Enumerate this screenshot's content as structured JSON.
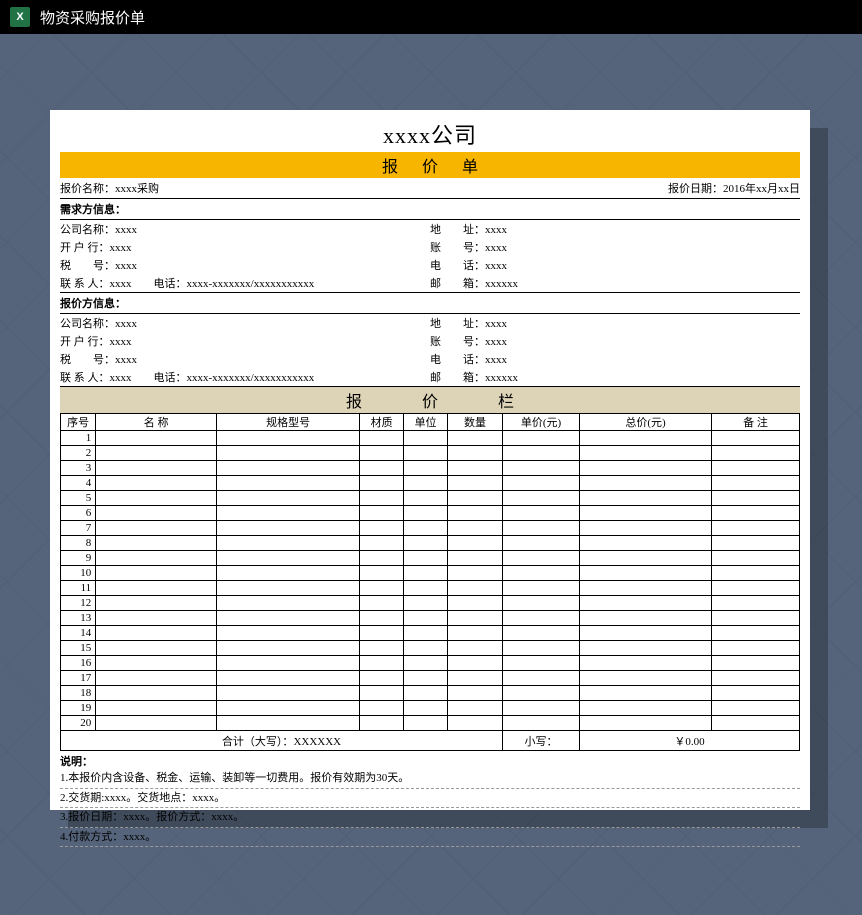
{
  "titlebar": "物资采购报价单",
  "company": "xxxx公司",
  "banner": "报价单",
  "meta": {
    "name_label": "报价名称：",
    "name_value": "xxxx采购",
    "date_label": "报价日期：",
    "date_value": "2016年xx月xx日"
  },
  "demand": {
    "section": "需求方信息：",
    "company_label": "公司名称：",
    "company_value": "xxxx",
    "bank_label": "开 户 行：",
    "bank_value": "xxxx",
    "tax_label": "税　　号：",
    "tax_value": "xxxx",
    "contact_label": "联 系 人：",
    "contact_value": "xxxx",
    "phone_label": "电话：",
    "phone_value": "xxxx-xxxxxxx/xxxxxxxxxxx",
    "addr_label": "地　　址：",
    "addr_value": "xxxx",
    "account_label": "账　　号：",
    "account_value": "xxxx",
    "tel_label": "电　　话：",
    "tel_value": "xxxx",
    "mail_label": "邮　　箱：",
    "mail_value": "xxxxxx"
  },
  "supply": {
    "section": "报价方信息：",
    "company_label": "公司名称：",
    "company_value": "xxxx",
    "bank_label": "开 户 行：",
    "bank_value": "xxxx",
    "tax_label": "税　　号：",
    "tax_value": "xxxx",
    "contact_label": "联 系 人：",
    "contact_value": "xxxx",
    "phone_label": "电话：",
    "phone_value": "xxxx-xxxxxxx/xxxxxxxxxxx",
    "addr_label": "地　　址：",
    "addr_value": "xxxx",
    "account_label": "账　　号：",
    "account_value": "xxxx",
    "tel_label": "电　　话：",
    "tel_value": "xxxx",
    "mail_label": "邮　　箱：",
    "mail_value": "xxxxxx"
  },
  "quote_header": "报价栏",
  "columns": {
    "seq": "序号",
    "name": "名 称",
    "spec": "规格型号",
    "mat": "材质",
    "unit": "单位",
    "qty": "数量",
    "price": "单价(元)",
    "total": "总价(元)",
    "note": "备 注"
  },
  "rows": [
    "1",
    "2",
    "3",
    "4",
    "5",
    "6",
    "7",
    "8",
    "9",
    "10",
    "11",
    "12",
    "13",
    "14",
    "15",
    "16",
    "17",
    "18",
    "19",
    "20"
  ],
  "totals": {
    "upper_label": "合计（大写）：",
    "upper_value": "XXXXXX",
    "lower_label": "小写：",
    "lower_value": "￥0.00"
  },
  "notes": {
    "title": "说明：",
    "l1": "1.本报价内含设备、税金、运输、装卸等一切费用。报价有效期为30天。",
    "l2": "2.交货期:xxxx。交货地点：xxxx。",
    "l3": "3.报价日期：xxxx。报价方式：xxxx。",
    "l4": "4.付款方式：xxxx。"
  }
}
